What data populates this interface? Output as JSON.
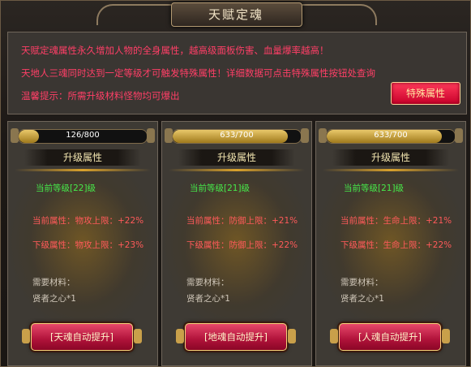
{
  "window": {
    "title": "天赋定魂"
  },
  "info": {
    "line1": "天赋定魂属性永久增加人物的全身属性，越高级面板伤害、血量爆率越高！",
    "line2": "天地人三魂同时达到一定等级才可触发特殊属性！详细数据可点击特殊属性按钮处查询",
    "line3": "温馨提示：所需升级材料怪物均可爆出",
    "special_button": "特殊属性"
  },
  "panels": [
    {
      "progress_text": "126/800",
      "progress_fraction": 0.16,
      "section_title": "升级属性",
      "current_level": "当前等级[22]级",
      "current_attr": "当前属性：物攻上限：+22%",
      "next_attr": "下级属性：物攻上限：+23%",
      "materials_label": "需要材料：",
      "material_item": "贤者之心*1",
      "button": "[天魂自动提升]"
    },
    {
      "progress_text": "633/700",
      "progress_fraction": 0.9,
      "section_title": "升级属性",
      "current_level": "当前等级[21]级",
      "current_attr": "当前属性：防御上限：+21%",
      "next_attr": "下级属性：防御上限：+22%",
      "materials_label": "需要材料：",
      "material_item": "贤者之心*1",
      "button": "[地魂自动提升]"
    },
    {
      "progress_text": "633/700",
      "progress_fraction": 0.9,
      "section_title": "升级属性",
      "current_level": "当前等级[21]级",
      "current_attr": "当前属性：生命上限：+21%",
      "next_attr": "下级属性：生命上限：+22%",
      "materials_label": "需要材料：",
      "material_item": "贤者之心*1",
      "button": "[人魂自动提升]"
    }
  ],
  "colors": {
    "warning_text": "#ff3f67",
    "level_text": "#46e84a",
    "attr_text": "#ff5a5a",
    "button_red": "#c8002a",
    "gold": "#d9a12c"
  }
}
